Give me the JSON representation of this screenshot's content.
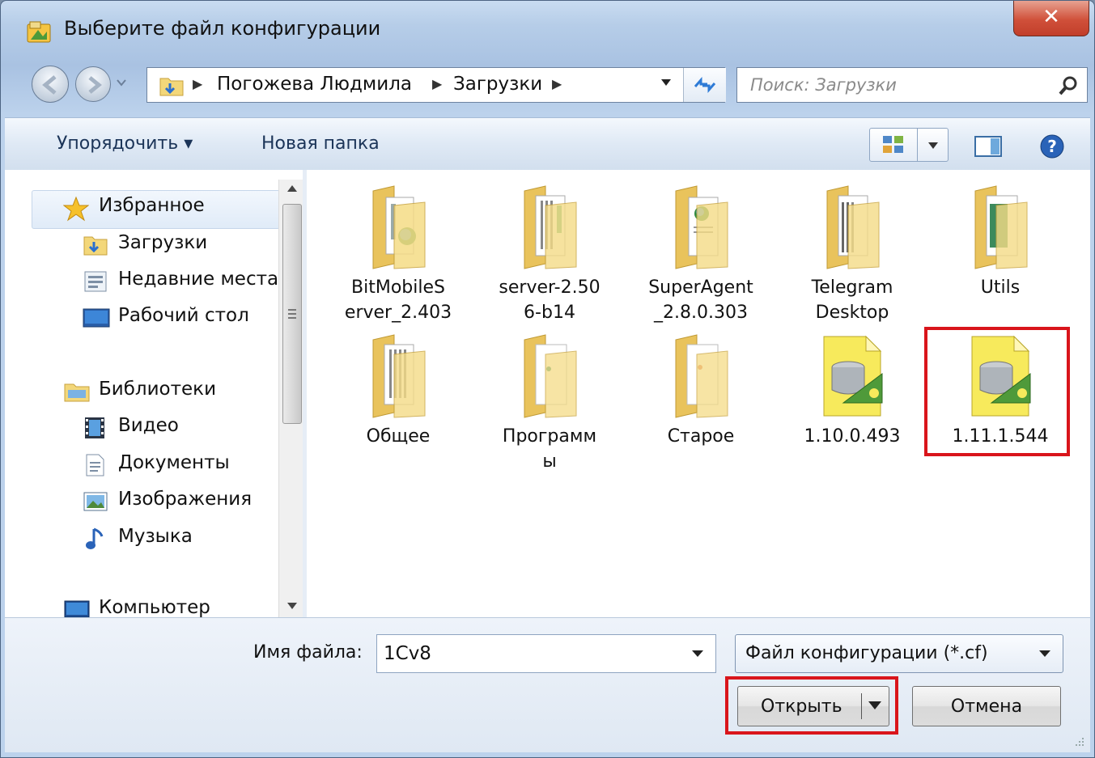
{
  "window": {
    "title": "Выберите файл конфигурации",
    "close_label": "✕"
  },
  "address": {
    "segments": [
      "Погожева Людмила",
      "Загрузки"
    ],
    "search_placeholder": "Поиск: Загрузки"
  },
  "toolbar": {
    "organize_label": "Упорядочить ▾",
    "new_folder_label": "Новая папка"
  },
  "nav": {
    "favorites_label": "Избранное",
    "downloads_label": "Загрузки",
    "recent_label": "Недавние места",
    "desktop_label": "Рабочий стол",
    "libraries_label": "Библиотеки",
    "video_label": "Видео",
    "documents_label": "Документы",
    "images_label": "Изображения",
    "music_label": "Музыка",
    "computer_label": "Компьютер"
  },
  "files": [
    {
      "line1": "BitMobileS",
      "line2": "erver_2.403",
      "kind": "folder-globe-icon"
    },
    {
      "line1": "server-2.50",
      "line2": "6-b14",
      "kind": "folder-docs-icon"
    },
    {
      "line1": "SuperAgent",
      "line2": "_2.8.0.303",
      "kind": "folder-globe-icon"
    },
    {
      "line1": "Telegram",
      "line2": "Desktop",
      "kind": "folder-docs-icon"
    },
    {
      "line1": "Utils",
      "line2": "",
      "kind": "folder-green-icon"
    },
    {
      "line1": "Общее",
      "line2": "",
      "kind": "folder-docs-icon"
    },
    {
      "line1": "Программ",
      "line2": "ы",
      "kind": "folder-docs-icon"
    },
    {
      "line1": "Старое",
      "line2": "",
      "kind": "folder-docs-icon"
    },
    {
      "line1": "1.10.0.493",
      "line2": "",
      "kind": "config-file-icon"
    },
    {
      "line1": "1.11.1.544",
      "line2": "",
      "kind": "config-file-icon"
    }
  ],
  "bottom": {
    "filename_label": "Имя файла:",
    "filename_value": "1Cv8",
    "filetype_value": "Файл конфигурации (*.cf)",
    "open_label": "Открыть",
    "cancel_label": "Отмена"
  },
  "colors": {
    "highlight": "#d9151b",
    "folder": "#f3d77a"
  }
}
